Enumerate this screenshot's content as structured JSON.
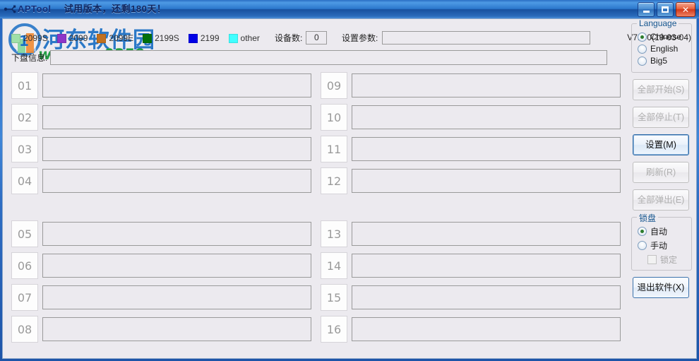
{
  "window": {
    "app_title": "APTool",
    "trial_notice": "试用版本，还剩180天！",
    "icon": "usb-device-icon",
    "minimize_label": "Minimize",
    "maximize_label": "Maximize",
    "close_label": "Close"
  },
  "watermark": {
    "site_name": "河东软件园",
    "site_url": "www.pc0359.cn"
  },
  "legend": {
    "items": [
      {
        "label": "2099S",
        "color": "#9fe0a8"
      },
      {
        "label": "2099",
        "color": "#8d36c8"
      },
      {
        "label": "2099E",
        "color": "#c2701f"
      },
      {
        "label": "2199S",
        "color": "#00700c"
      },
      {
        "label": "2199",
        "color": "#0000e6"
      },
      {
        "label": "other",
        "color": "#40ffff"
      }
    ]
  },
  "toolbar": {
    "device_count_label": "设备数:",
    "device_count_value": "0",
    "param_label": "设置参数:",
    "param_value": "",
    "param_placeholder": "",
    "version": "V7100(19-03-04)"
  },
  "disk_info": {
    "label": "下盘信息:",
    "value": "",
    "placeholder": ""
  },
  "devices": {
    "left": [
      {
        "num": "01",
        "status": ""
      },
      {
        "num": "02",
        "status": ""
      },
      {
        "num": "03",
        "status": ""
      },
      {
        "num": "04",
        "status": ""
      },
      {
        "num": "05",
        "status": ""
      },
      {
        "num": "06",
        "status": ""
      },
      {
        "num": "07",
        "status": ""
      },
      {
        "num": "08",
        "status": ""
      }
    ],
    "right": [
      {
        "num": "09",
        "status": ""
      },
      {
        "num": "10",
        "status": ""
      },
      {
        "num": "11",
        "status": ""
      },
      {
        "num": "12",
        "status": ""
      },
      {
        "num": "13",
        "status": ""
      },
      {
        "num": "14",
        "status": ""
      },
      {
        "num": "15",
        "status": ""
      },
      {
        "num": "16",
        "status": ""
      }
    ]
  },
  "language_group": {
    "caption": "Language",
    "options": [
      {
        "label": "Chinese",
        "selected": true
      },
      {
        "label": "English",
        "selected": false
      },
      {
        "label": "Big5",
        "selected": false
      }
    ]
  },
  "actions": {
    "start_all": "全部开始(S)",
    "stop_all": "全部停止(T)",
    "settings": "设置(M)",
    "refresh": "刷新(R)",
    "eject_all": "全部弹出(E)",
    "exit": "退出软件(X)"
  },
  "lock_group": {
    "caption": "锁盘",
    "auto": "自动",
    "manual": "手动",
    "lock_checkbox": "锁定"
  },
  "colors": {
    "title_blue": "#2b77cc",
    "client_bg": "#eceaef",
    "focus_blue": "#3c72ab",
    "group_caption": "#16568f",
    "watermark_blue": "#1b6fc4",
    "watermark_green": "#1a9a3c"
  }
}
